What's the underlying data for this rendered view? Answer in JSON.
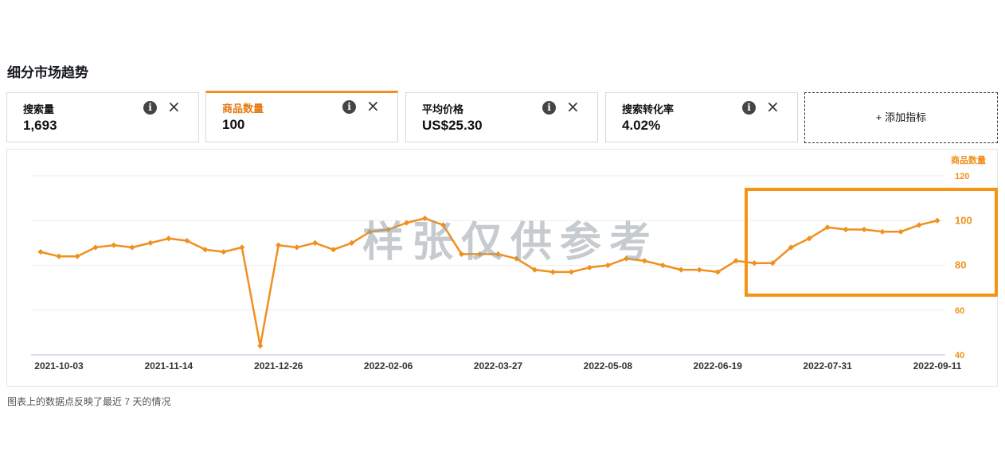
{
  "section_title": "细分市场趋势",
  "metrics": [
    {
      "label": "搜索量",
      "value": "1,693",
      "active": false
    },
    {
      "label": "商品数量",
      "value": "100",
      "active": true
    },
    {
      "label": "平均价格",
      "value": "US$25.30",
      "active": false
    },
    {
      "label": "搜索转化率",
      "value": "4.02%",
      "active": false
    }
  ],
  "add_metric_label": "+ 添加指标",
  "watermark": "样张仅供参考",
  "footnote": "图表上的数据点反映了最近 7 天的情况",
  "colors": {
    "accent": "#f0901e",
    "axis": "#c9d6e3",
    "grid": "#eeeeee"
  },
  "icons": {
    "info": "info-icon",
    "close": "close-icon"
  },
  "chart_data": {
    "type": "line",
    "y_axis_title": "商品数量",
    "y_axis_position": "right",
    "yticks": [
      40,
      60,
      80,
      100,
      120
    ],
    "ylim": [
      40,
      120
    ],
    "x_tick_labels": [
      "2021-10-03",
      "2021-11-14",
      "2021-12-26",
      "2022-02-06",
      "2022-03-27",
      "2022-05-08",
      "2022-06-19",
      "2022-07-31",
      "2022-09-11"
    ],
    "x_tick_indices": [
      1,
      7,
      13,
      19,
      25,
      31,
      37,
      43,
      49
    ],
    "grid": true,
    "series": [
      {
        "values": [
          86,
          84,
          84,
          88,
          89,
          88,
          90,
          92,
          91,
          87,
          86,
          88,
          44,
          89,
          88,
          90,
          87,
          90,
          95,
          96,
          99,
          101,
          98,
          85,
          85,
          85,
          83,
          78,
          77,
          77,
          79,
          80,
          83,
          82,
          80,
          78,
          78,
          77,
          82,
          81,
          81,
          88,
          92,
          97,
          96,
          96,
          95,
          95,
          98,
          100
        ],
        "color": "#f0901e"
      }
    ]
  }
}
